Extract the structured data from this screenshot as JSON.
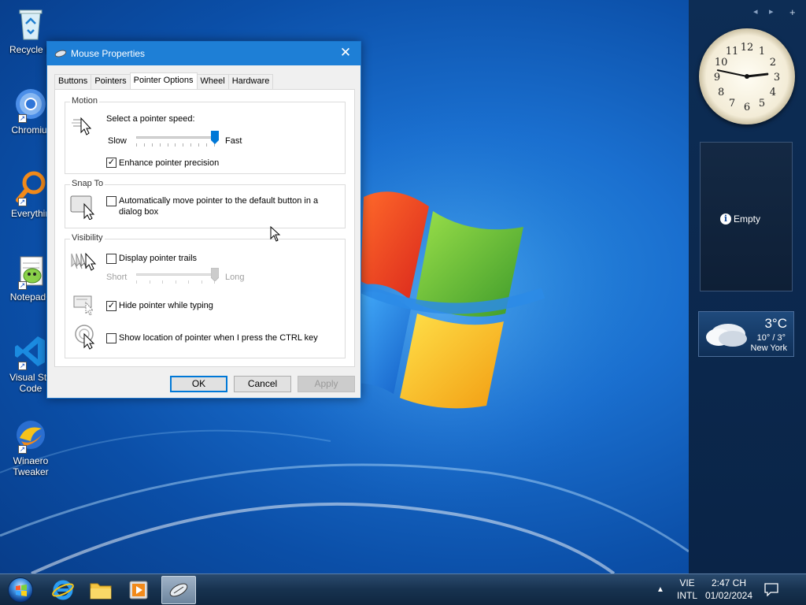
{
  "desktop": {
    "icons": [
      {
        "label": "Recycle Bin",
        "icon": "recycle-bin-icon"
      },
      {
        "label": "Chromium",
        "icon": "chromium-icon"
      },
      {
        "label": "Everything",
        "icon": "everything-search-icon"
      },
      {
        "label": "Notepad++",
        "icon": "notepad-plus-plus-icon"
      },
      {
        "label": "Visual Studio Code",
        "icon": "vscode-icon"
      },
      {
        "label": "Winaero Tweaker",
        "icon": "winaero-tweaker-icon"
      }
    ],
    "visible_labels": {
      "recycle": "Recycle B",
      "chromium": "Chromiur",
      "everything": "Everythin",
      "notepad": "Notepad+",
      "vscode_1": "Visual Stu",
      "vscode_2": "Code",
      "winaero_1": "Winaero",
      "winaero_2": "Tweaker"
    }
  },
  "dialog": {
    "title": "Mouse Properties",
    "tabs": [
      "Buttons",
      "Pointers",
      "Pointer Options",
      "Wheel",
      "Hardware"
    ],
    "active_tab": "Pointer Options",
    "motion": {
      "group_title": "Motion",
      "speed_label": "Select a pointer speed:",
      "slow_label": "Slow",
      "fast_label": "Fast",
      "speed_value": 1.0,
      "enhance_label": "Enhance pointer precision",
      "enhance_checked": true
    },
    "snap_to": {
      "group_title": "Snap To",
      "label_line1": "Automatically move pointer to the default button in a",
      "label_line2": "dialog box",
      "checked": false
    },
    "visibility": {
      "group_title": "Visibility",
      "trails_label": "Display pointer trails",
      "trails_checked": false,
      "short_label": "Short",
      "long_label": "Long",
      "trails_value": 1.0,
      "hide_label": "Hide pointer while typing",
      "hide_checked": true,
      "ctrl_label": "Show location of pointer when I press the CTRL key",
      "ctrl_checked": false
    },
    "buttons": {
      "ok": "OK",
      "cancel": "Cancel",
      "apply": "Apply"
    }
  },
  "sidebar": {
    "slideshow_text": "Empty",
    "weather": {
      "temp": "3°C",
      "range": "10° / 3°",
      "city": "New York"
    },
    "clock_time": "2:47",
    "clock_numbers": [
      "12",
      "1",
      "2",
      "3",
      "4",
      "5",
      "6",
      "7",
      "8",
      "9",
      "10",
      "11"
    ]
  },
  "taskbar": {
    "apps": [
      "start-button",
      "internet-explorer-icon",
      "file-explorer-icon",
      "media-player-icon",
      "mouse-properties-icon"
    ],
    "lang_line1": "VIE",
    "lang_line2": "INTL",
    "time": "2:47 CH",
    "date": "01/02/2024"
  },
  "colors": {
    "titlebar": "#1e7fd6",
    "default_button_border": "#0078d7",
    "wallpaper": "#1a6fcf"
  }
}
